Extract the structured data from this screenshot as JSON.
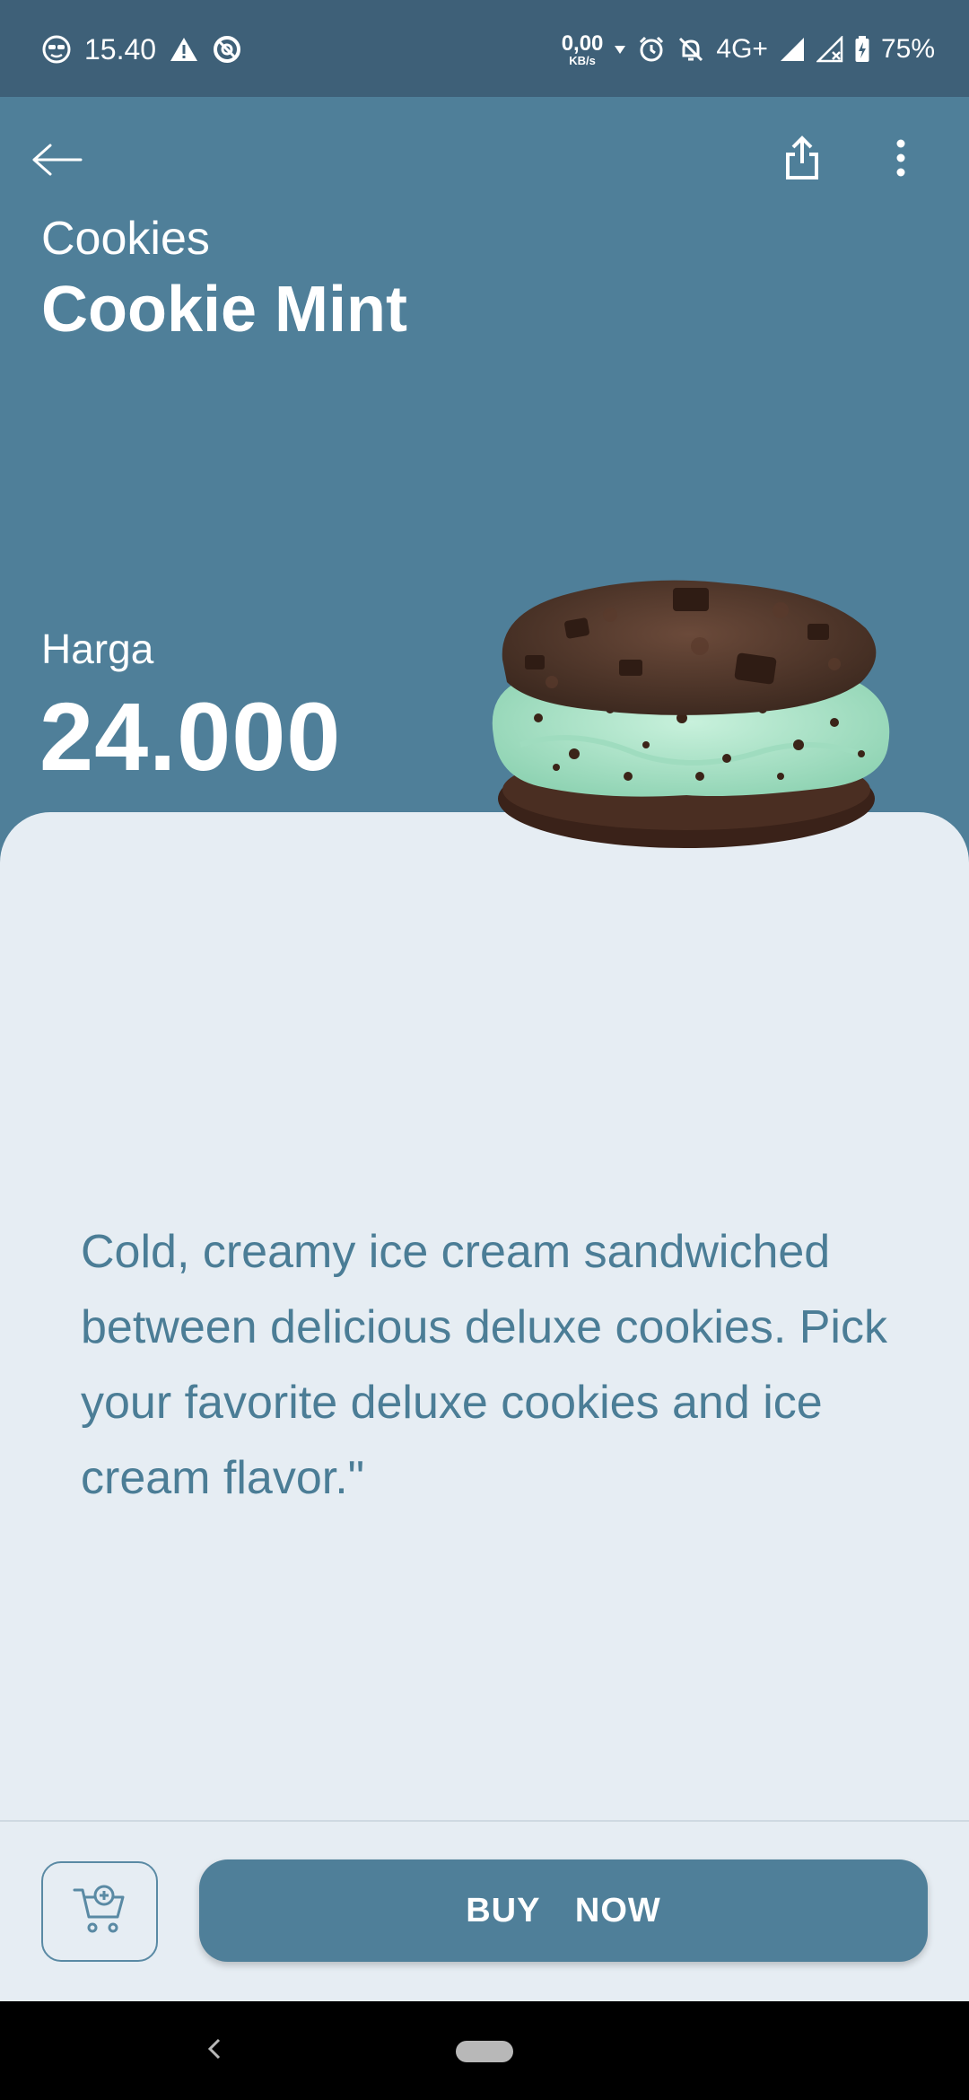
{
  "status_bar": {
    "time": "15.40",
    "speed_value": "0,00",
    "speed_unit": "KB/s",
    "network": "4G+",
    "battery": "75%"
  },
  "header": {
    "back_icon": "arrow-left-icon",
    "share_icon": "share-icon",
    "more_icon": "more-vertical-icon"
  },
  "product": {
    "category": "Cookies",
    "name": "Cookie Mint",
    "price_label": "Harga",
    "price": "24.000",
    "description": "Cold, creamy ice cream sandwiched between delicious deluxe cookies. Pick your favorite deluxe cookies and ice cream flavor.\"",
    "image": "ice-cream-cookie-sandwich"
  },
  "actions": {
    "cart_icon": "add-to-cart-icon",
    "buy_label": "BUY  NOW"
  },
  "colors": {
    "primary": "#4f7f99",
    "status_bar": "#3e6078",
    "surface": "#e6edf3",
    "text_accent": "#4b7d96"
  }
}
